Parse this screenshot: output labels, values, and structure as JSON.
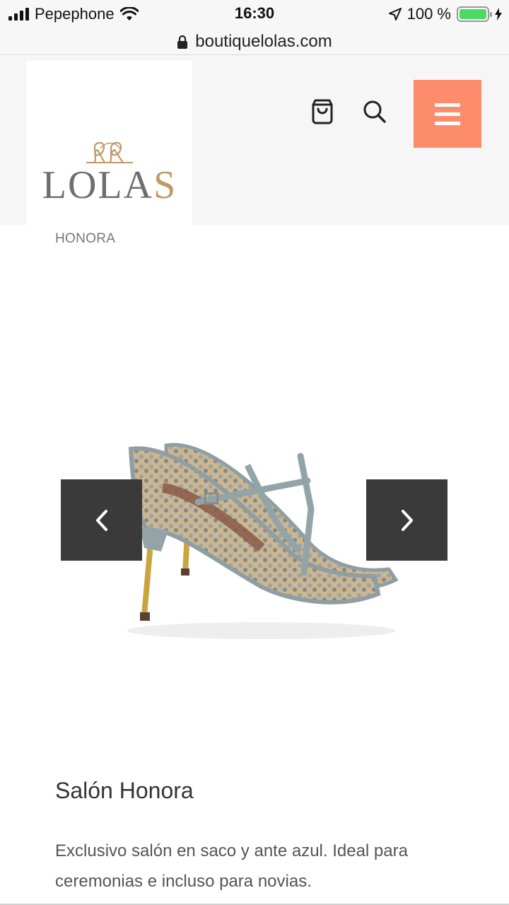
{
  "status_bar": {
    "carrier": "Pepephone",
    "time": "16:30",
    "battery": "100 %",
    "battery_color": "#4cd964"
  },
  "browser": {
    "url": "boutiquelolas.com",
    "lock_icon": "lock-icon"
  },
  "header": {
    "logo_text_main": "LOLA",
    "logo_text_accent": "S",
    "brand_accent": "#bf9966",
    "menu_color": "#fc8c6c",
    "icons": [
      "cart-icon",
      "search-icon",
      "hamburger-menu-icon"
    ]
  },
  "breadcrumb": {
    "current": "HONORA"
  },
  "gallery": {
    "prev_icon": "chevron-left-icon",
    "next_icon": "chevron-right-icon",
    "image": "product-shoe-image"
  },
  "product": {
    "title": "Salón Honora",
    "description": "Exclusivo salón en saco y ante azul. Ideal para ceremonias e incluso para novias."
  }
}
